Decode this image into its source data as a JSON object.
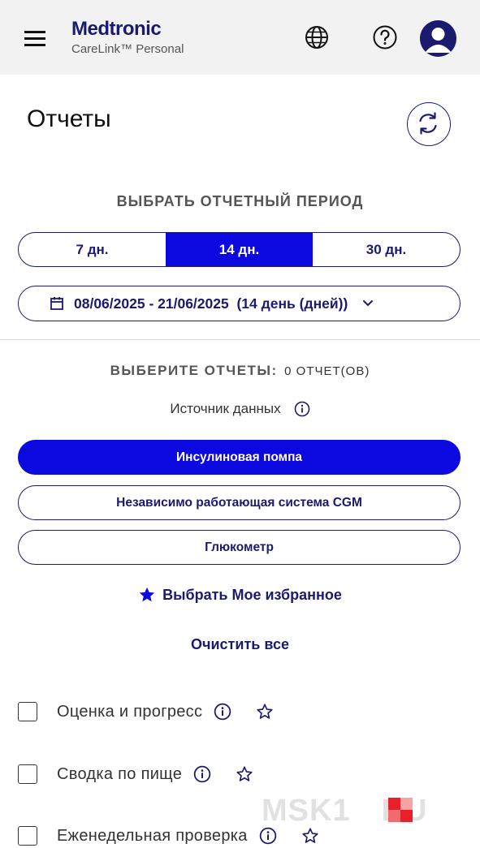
{
  "header": {
    "brand_name": "Medtronic",
    "brand_sub": "CareLink™ Personal",
    "icons": [
      "menu-icon",
      "globe-icon",
      "help-icon",
      "user-icon"
    ]
  },
  "page": {
    "title": "Отчеты"
  },
  "period": {
    "label": "ВЫБРАТЬ ОТЧЕТНЫЙ ПЕРИОД",
    "options": [
      "7 дн.",
      "14 дн.",
      "30 дн."
    ],
    "selected": "14 дн.",
    "date_range": "08/06/2025 - 21/06/2025  (14 день (дней))"
  },
  "reports": {
    "choose_label": "ВЫБЕРИТЕ ОТЧЕТЫ:",
    "count": "0 ОТЧЕТ(ОВ)",
    "data_source_label": "Источник данных",
    "sources": [
      "Инсулиновая помпа",
      "Независимо работающая система CGM",
      "Глюкометр"
    ],
    "selected_source": "Инсулиновая помпа",
    "favorites_link": "Выбрать Мое избранное",
    "clear_link": "Очистить все",
    "items": [
      {
        "label": "Оценка и прогресс",
        "checked": false
      },
      {
        "label": "Сводка по пище",
        "checked": false
      },
      {
        "label": "Еженедельная проверка",
        "checked": false
      }
    ]
  },
  "colors": {
    "primary": "#0b08e0",
    "navy": "#1a1a6e",
    "header_bg": "#f2f2f2"
  },
  "watermark": {
    "text_left": "MSK1",
    "text_right": "RU"
  }
}
